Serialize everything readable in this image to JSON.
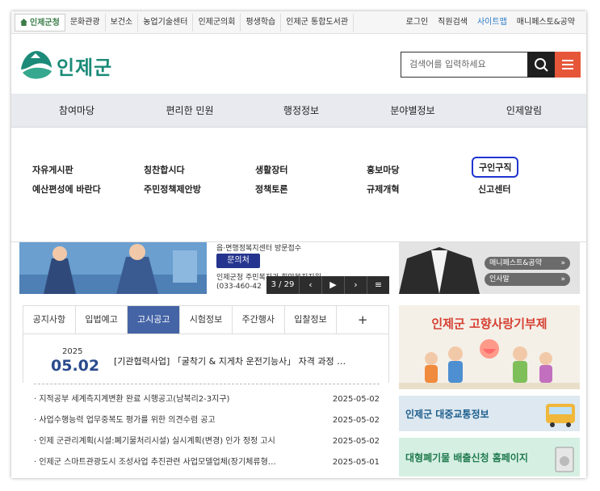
{
  "topbar": {
    "left_links": [
      "인제군청",
      "문화관광",
      "보건소",
      "농업기술센터",
      "인제군의회",
      "평생학습",
      "인제군 통합도서관"
    ],
    "right_links": [
      "로그인",
      "직원검색",
      "사이트맵",
      "매니페스토&공약"
    ]
  },
  "header": {
    "logo_text": "인제군",
    "search_placeholder": "검색어를 입력하세요"
  },
  "gnb": [
    "참여마당",
    "편리한 민원",
    "행정정보",
    "분야별정보",
    "인제알림"
  ],
  "dropdown": {
    "row1": [
      "자유게시판",
      "칭찬합시다",
      "생활장터",
      "홍보마당",
      "구인구직"
    ],
    "row2": [
      "예산편성에 바란다",
      "주민정책제안방",
      "정책토론",
      "규제개혁",
      "신고센터"
    ]
  },
  "visual": {
    "line1": "읍·면행정복지센터 방문접수",
    "button": "문의처",
    "line2": "인제군청 주민복지과 희망복지지원",
    "line3": "(033-460-42",
    "counter": "3 / 29"
  },
  "right_visual": {
    "btn1": "매니페스트&공약",
    "btn2": "인사말"
  },
  "tabs": [
    "공지사항",
    "입법예고",
    "고시공고",
    "시험정보",
    "주간행사",
    "입찰정보",
    "+"
  ],
  "feature": {
    "year": "2025",
    "date": "05.02",
    "title": "[기관협력사업] 「굴착기 & 지게차 운전기능사」 자격 과정 …"
  },
  "notices": [
    {
      "title": "· 지적공부 세계측지계변환 완료 시행공고(남북리2-3지구)",
      "date": "2025-05-02"
    },
    {
      "title": "· 사업수행능력 업무중복도 평가를 위한 의견수렴 공고",
      "date": "2025-05-02"
    },
    {
      "title": "· 인제 군관리계획(시설:폐기물처리시설) 실시계획(변경) 인가 정정 고시",
      "date": "2025-05-02"
    },
    {
      "title": "· 인제군 스마트관광도시 조성사업 추진관련 사업모델업체(장기체류형…",
      "date": "2025-05-01"
    }
  ],
  "banners": {
    "b1": "인제군 고향사랑기부제",
    "b2": "인제군 대중교통정보",
    "b3": "대형폐기물 배출신청 홈페이지"
  },
  "colors": {
    "brand_green": "#1b8a78",
    "tab_active": "#4564a6",
    "menu_red": "#e6573a",
    "highlight_ring": "#2035d1"
  }
}
